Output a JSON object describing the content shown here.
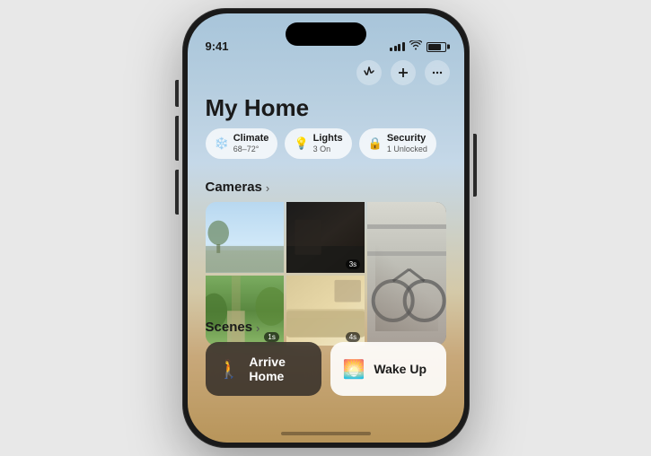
{
  "phone": {
    "status": {
      "time": "9:41",
      "signal_bars": [
        4,
        6,
        8,
        10,
        12
      ],
      "battery_level": "80%"
    },
    "header": {
      "title": "My Home",
      "add_button_label": "+",
      "voice_button_label": "voice",
      "more_button_label": "..."
    },
    "chips": [
      {
        "id": "climate",
        "icon": "❄️",
        "title": "Climate",
        "subtitle": "68–72°"
      },
      {
        "id": "lights",
        "icon": "💡",
        "title": "Lights",
        "subtitle": "3 On"
      },
      {
        "id": "security",
        "icon": "🔒",
        "title": "Security",
        "subtitle": "1 Unlocked"
      }
    ],
    "cameras": {
      "section_title": "Cameras",
      "section_arrow": "›",
      "items": [
        {
          "id": "cam1",
          "badge": ""
        },
        {
          "id": "cam2",
          "badge": "3s"
        },
        {
          "id": "cam3",
          "badge": ""
        },
        {
          "id": "cam4",
          "badge": "1s"
        },
        {
          "id": "cam5",
          "badge": "4s"
        }
      ]
    },
    "scenes": {
      "section_title": "Scenes",
      "section_arrow": "›",
      "items": [
        {
          "id": "arrive-home",
          "label": "Arrive Home",
          "icon": "🚶",
          "style": "dark"
        },
        {
          "id": "wake-up",
          "label": "Wake Up",
          "icon": "🌅",
          "style": "light"
        }
      ]
    }
  }
}
